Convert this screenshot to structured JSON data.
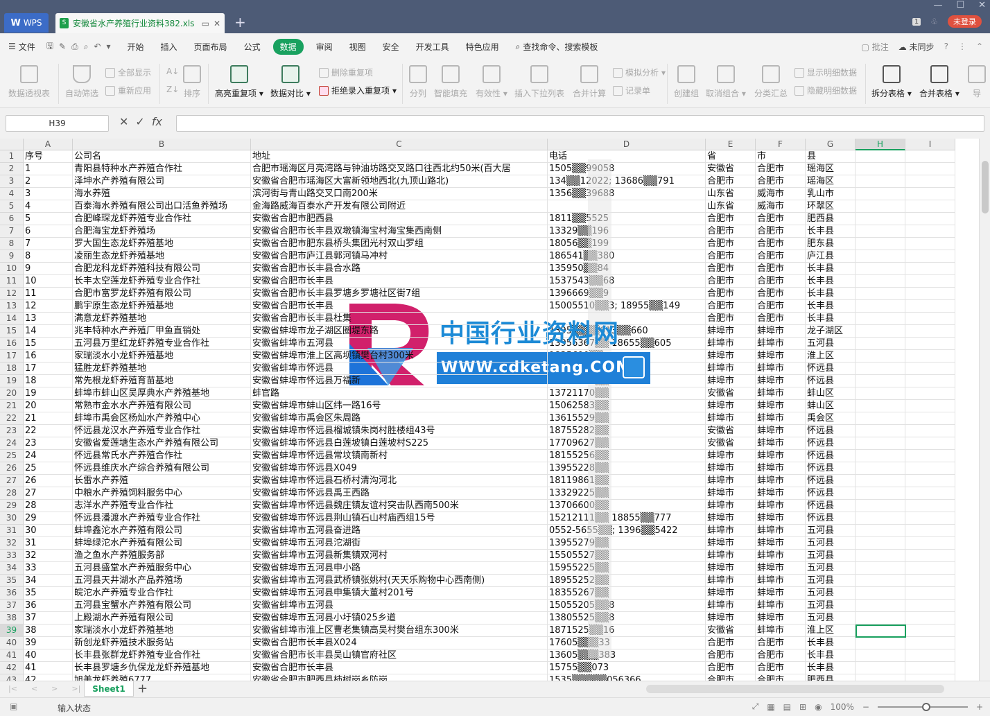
{
  "titlebar": {
    "wps_label": "WPS",
    "doc_title": "安徽省水产养殖行业资料382.xls",
    "login": "未登录",
    "badge": "1"
  },
  "menu": {
    "file": "文件",
    "items": [
      "开始",
      "插入",
      "页面布局",
      "公式",
      "数据",
      "审阅",
      "视图",
      "安全",
      "开发工具",
      "特色应用"
    ],
    "active": "数据",
    "search": "查找命令、搜索模板",
    "comment": "批注",
    "sync": "未同步"
  },
  "ribbon": {
    "pivot": "数据透视表",
    "autofilter": "自动筛选",
    "showall": "全部显示",
    "reapply": "重新应用",
    "sort": "排序",
    "highlight_dup": "高亮重复项",
    "compare": "数据对比",
    "delete_dup": "删除重复项",
    "reject_dup": "拒绝录入重复项",
    "split": "分列",
    "smart_fill": "智能填充",
    "validity": "有效性",
    "insert_dropdown": "插入下拉列表",
    "merge_calc": "合并计算",
    "simulate": "模拟分析",
    "record": "记录单",
    "create_group": "创建组",
    "ungroup": "取消组合",
    "subtotal": "分类汇总",
    "show_detail": "显示明细数据",
    "hide_detail": "隐藏明细数据",
    "split_table": "拆分表格",
    "merge_table": "合并表格",
    "more": "导"
  },
  "formula": {
    "cell_ref": "H39",
    "cancel": "✕",
    "confirm": "✓",
    "fx": "fx"
  },
  "columns": [
    "A",
    "B",
    "C",
    "D",
    "E",
    "F",
    "G",
    "H",
    "I"
  ],
  "rows": [
    [
      "序号",
      "公司名",
      "地址",
      "电话",
      "省",
      "市",
      "县"
    ],
    [
      "1",
      "青阳县特种水产养殖合作社",
      "合肥市瑶海区月亮湾路与钟油坊路交叉路口往西北约50米(百大居",
      "1505▒▒99058",
      "安徽省",
      "合肥市",
      "瑶海区"
    ],
    [
      "2",
      "泽坤水产养殖有限公司",
      "安徽省合肥市瑶海区大富新领地西北(九顶山路北)",
      "134▒▒12022; 13686▒▒791",
      "合肥市",
      "合肥市",
      "瑶海区"
    ],
    [
      "3",
      "海水养殖",
      "滨河街与青山路交叉口南200米",
      "1356▒▒39688",
      "山东省",
      "威海市",
      "乳山市"
    ],
    [
      "4",
      "百泰海水养殖有限公司出口活鱼养殖场",
      "金海路威海百泰水产开发有限公司附近",
      "",
      "山东省",
      "威海市",
      "环翠区"
    ],
    [
      "5",
      "合肥峰琛龙虾养殖专业合作社",
      "安徽省合肥市肥西县",
      "1811▒▒5525",
      "合肥市",
      "合肥市",
      "肥西县"
    ],
    [
      "6",
      "合肥海宝龙虾养殖场",
      "安徽省合肥市长丰县双墩镇海宝村海宝集西南侧",
      "13329▒▒196",
      "合肥市",
      "合肥市",
      "长丰县"
    ],
    [
      "7",
      "罗大国生态龙虾养殖基地",
      "安徽省合肥市肥东县桥头集团光村双山罗组",
      "18056▒▒199",
      "合肥市",
      "合肥市",
      "肥东县"
    ],
    [
      "8",
      "凌丽生态龙虾养殖基地",
      "安徽省合肥市庐江县郭河镇马冲村",
      "186541▒▒380",
      "合肥市",
      "合肥市",
      "庐江县"
    ],
    [
      "9",
      "合肥龙科龙虾养殖科技有限公司",
      "安徽省合肥市长丰县合水路",
      "135950▒▒84",
      "合肥市",
      "合肥市",
      "长丰县"
    ],
    [
      "10",
      "长丰太空莲龙虾养殖专业合作社",
      "安徽省合肥市长丰县",
      "1537543▒▒68",
      "合肥市",
      "合肥市",
      "长丰县"
    ],
    [
      "11",
      "合肥市富罗龙虾养殖有限公司",
      "安徽省合肥市长丰县罗塘乡罗塘社区街7组",
      "1396669▒▒9",
      "合肥市",
      "合肥市",
      "长丰县"
    ],
    [
      "12",
      "鹏宇原生态龙虾养殖基地",
      "安徽省合肥市长丰县",
      "15005510▒▒3; 18955▒▒149",
      "合肥市",
      "合肥市",
      "长丰县"
    ],
    [
      "13",
      "满意龙虾养殖基地",
      "安徽省合肥市长丰县杜集",
      "",
      "合肥市",
      "合肥市",
      "长丰县"
    ],
    [
      "14",
      "兆丰特种水产养殖厂甲鱼直销处",
      "安徽省蚌埠市龙子湖区圈堤东路",
      "1395▒▒▒▒613▒▒660",
      "蚌埠市",
      "蚌埠市",
      "龙子湖区"
    ],
    [
      "15",
      "五河县万里红龙虾养殖专业合作社",
      "安徽省蚌埠市五河县",
      "13956367▒▒ 18655▒▒605",
      "蚌埠市",
      "蚌埠市",
      "五河县"
    ],
    [
      "16",
      "家瑞淡水小龙虾养殖基地",
      "安徽省蚌埠市淮上区高坝镇樊台村300米",
      "1835690▒▒",
      "蚌埠市",
      "蚌埠市",
      "淮上区"
    ],
    [
      "17",
      "猛胜龙虾养殖基地",
      "安徽省蚌埠市怀远县",
      "1357▒▒▒▒",
      "蚌埠市",
      "蚌埠市",
      "怀远县"
    ],
    [
      "18",
      "常先根龙虾养殖育苗基地",
      "安徽省蚌埠市怀远县万福新",
      "13721168▒▒",
      "蚌埠市",
      "蚌埠市",
      "怀远县"
    ],
    [
      "19",
      "蚌埠市蚌山区吴厚典水产养殖基地",
      "蚌官路",
      "13721170▒▒",
      "安徽省",
      "蚌埠市",
      "蚌山区"
    ],
    [
      "20",
      "常熟市金水水产养殖有限公司",
      "安徽省蚌埠市蚌山区纬一路16号",
      "15062583▒▒",
      "蚌埠市",
      "蚌埠市",
      "蚌山区"
    ],
    [
      "21",
      "蚌埠市禹会区杨灿水产养殖中心",
      "安徽省蚌埠市禹会区朱周路",
      "13615529▒▒",
      "蚌埠市",
      "蚌埠市",
      "禹会区"
    ],
    [
      "22",
      "怀远县龙汉水产养殖专业合作社",
      "安徽省蚌埠市怀远县榴城镇朱岗村胜楼组43号",
      "18755282▒▒",
      "安徽省",
      "蚌埠市",
      "怀远县"
    ],
    [
      "23",
      "安徽省爱莲塘生态水产养殖有限公司",
      "安徽省蚌埠市怀远县白莲坡镇白莲坡村S225",
      "17709627▒▒",
      "安徽省",
      "蚌埠市",
      "怀远县"
    ],
    [
      "24",
      "怀远县常氏水产养殖合作社",
      "安徽省蚌埠市怀远县常坟镇南新村",
      "18155256▒▒",
      "蚌埠市",
      "蚌埠市",
      "怀远县"
    ],
    [
      "25",
      "怀远县维庆水产综合养殖有限公司",
      "安徽省蚌埠市怀远县X049",
      "13955228▒▒",
      "蚌埠市",
      "蚌埠市",
      "怀远县"
    ],
    [
      "26",
      "长雷水产养殖",
      "安徽省蚌埠市怀远县石桥村清沟河北",
      "18119861▒▒",
      "蚌埠市",
      "蚌埠市",
      "怀远县"
    ],
    [
      "27",
      "中粮水产养殖饲料服务中心",
      "安徽省蚌埠市怀远县禹王西路",
      "13329225▒▒",
      "蚌埠市",
      "蚌埠市",
      "怀远县"
    ],
    [
      "28",
      "志洋水产养殖专业合作社",
      "安徽省蚌埠市怀远县魏庄镇友谊村突击队西南500米",
      "13706600▒▒",
      "蚌埠市",
      "蚌埠市",
      "怀远县"
    ],
    [
      "29",
      "怀远县潘渡水产养殖专业合作社",
      "安徽省蚌埠市怀远县荆山镇石山村庙西组15号",
      "15212111▒▒ 18855▒▒777",
      "蚌埠市",
      "蚌埠市",
      "怀远县"
    ],
    [
      "30",
      "蚌埠鑫沱水产养殖有限公司",
      "安徽省蚌埠市五河县奋进路",
      "0552-5655▒▒; 1396▒▒5422",
      "蚌埠市",
      "蚌埠市",
      "五河县"
    ],
    [
      "31",
      "蚌埠绿沱水产养殖有限公司",
      "安徽省蚌埠市五河县沱湖街",
      "13955279▒▒",
      "蚌埠市",
      "蚌埠市",
      "五河县"
    ],
    [
      "32",
      "渔之鱼水产养殖服务部",
      "安徽省蚌埠市五河县新集镇双河村",
      "15505527▒▒",
      "蚌埠市",
      "蚌埠市",
      "五河县"
    ],
    [
      "33",
      "五河县盛堂水产养殖服务中心",
      "安徽省蚌埠市五河县申小路",
      "15955225▒▒",
      "蚌埠市",
      "蚌埠市",
      "五河县"
    ],
    [
      "34",
      "五河县天井湖水产品养殖场",
      "安徽省蚌埠市五河县武桥镇张姚村(天天乐购物中心西南侧)",
      "18955252▒▒",
      "蚌埠市",
      "蚌埠市",
      "五河县"
    ],
    [
      "35",
      "皖沱水产养殖专业合作社",
      "安徽省蚌埠市五河县申集镇大董村201号",
      "18355267▒▒",
      "蚌埠市",
      "蚌埠市",
      "五河县"
    ],
    [
      "36",
      "五河县宝蟹水产养殖有限公司",
      "安徽省蚌埠市五河县",
      "15055205▒▒8",
      "蚌埠市",
      "蚌埠市",
      "五河县"
    ],
    [
      "37",
      "上殿湖水产养殖有限公司",
      "安徽省蚌埠市五河县小圩镇025乡道",
      "13805525▒▒8",
      "蚌埠市",
      "蚌埠市",
      "五河县"
    ],
    [
      "38",
      "家瑞淡水小龙虾养殖基地",
      "安徽省蚌埠市淮上区曹老集镇高吴村樊台组东300米",
      "1871525▒▒16",
      "安徽省",
      "蚌埠市",
      "淮上区"
    ],
    [
      "39",
      "新创龙虾养殖技术服务站",
      "安徽省合肥市长丰县X024",
      "17605▒▒▒33",
      "合肥市",
      "合肥市",
      "长丰县"
    ],
    [
      "40",
      "长丰县张群龙虾养殖专业合作社",
      "安徽省合肥市长丰县吴山镇官府社区",
      "13605▒▒▒383",
      "合肥市",
      "合肥市",
      "长丰县"
    ],
    [
      "41",
      "长丰县罗塘乡仇保龙龙虾养殖基地",
      "安徽省合肥市长丰县",
      "15755▒▒073",
      "合肥市",
      "合肥市",
      "长丰县"
    ],
    [
      "42",
      "旭美龙虾养殖6777",
      "安徽省合肥市肥西县柿树岗乡防岗",
      "1535▒▒▒▒▒056366",
      "合肥市",
      "合肥市",
      "肥西县"
    ]
  ],
  "watermark": {
    "title": "中国行业资料网",
    "url": "WWW.cdketang.COM"
  },
  "sheet": {
    "tab": "Sheet1",
    "add": "+"
  },
  "status": {
    "mode": "输入状态",
    "zoom": "100%"
  }
}
